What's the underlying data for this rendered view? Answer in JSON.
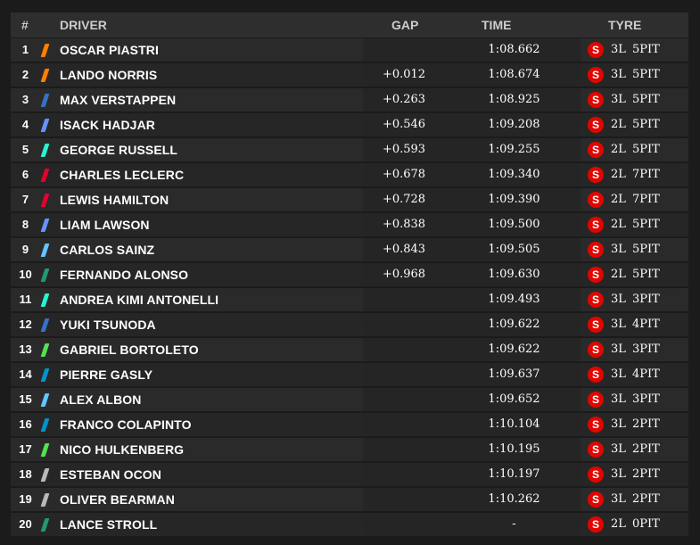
{
  "header": {
    "pos": "#",
    "driver": "DRIVER",
    "gap": "GAP",
    "time": "TIME",
    "tyre": "TYRE"
  },
  "rows": [
    {
      "pos": "1",
      "driver": "OSCAR PIASTRI",
      "gap": "",
      "time": "1:08.662",
      "tyre": "S",
      "laps": "3L",
      "pits": "5PIT",
      "color": "#ff8000"
    },
    {
      "pos": "2",
      "driver": "LANDO NORRIS",
      "gap": "+0.012",
      "time": "1:08.674",
      "tyre": "S",
      "laps": "3L",
      "pits": "5PIT",
      "color": "#ff8000"
    },
    {
      "pos": "3",
      "driver": "MAX VERSTAPPEN",
      "gap": "+0.263",
      "time": "1:08.925",
      "tyre": "S",
      "laps": "3L",
      "pits": "5PIT",
      "color": "#3671c6"
    },
    {
      "pos": "4",
      "driver": "ISACK HADJAR",
      "gap": "+0.546",
      "time": "1:09.208",
      "tyre": "S",
      "laps": "2L",
      "pits": "5PIT",
      "color": "#6692ff"
    },
    {
      "pos": "5",
      "driver": "GEORGE RUSSELL",
      "gap": "+0.593",
      "time": "1:09.255",
      "tyre": "S",
      "laps": "2L",
      "pits": "5PIT",
      "color": "#27f4d2"
    },
    {
      "pos": "6",
      "driver": "CHARLES LECLERC",
      "gap": "+0.678",
      "time": "1:09.340",
      "tyre": "S",
      "laps": "2L",
      "pits": "7PIT",
      "color": "#e8002d"
    },
    {
      "pos": "7",
      "driver": "LEWIS HAMILTON",
      "gap": "+0.728",
      "time": "1:09.390",
      "tyre": "S",
      "laps": "2L",
      "pits": "7PIT",
      "color": "#e8002d"
    },
    {
      "pos": "8",
      "driver": "LIAM LAWSON",
      "gap": "+0.838",
      "time": "1:09.500",
      "tyre": "S",
      "laps": "2L",
      "pits": "5PIT",
      "color": "#6692ff"
    },
    {
      "pos": "9",
      "driver": "CARLOS SAINZ",
      "gap": "+0.843",
      "time": "1:09.505",
      "tyre": "S",
      "laps": "3L",
      "pits": "5PIT",
      "color": "#64c4ff"
    },
    {
      "pos": "10",
      "driver": "FERNANDO ALONSO",
      "gap": "+0.968",
      "time": "1:09.630",
      "tyre": "S",
      "laps": "2L",
      "pits": "5PIT",
      "color": "#229971"
    },
    {
      "pos": "11",
      "driver": "ANDREA KIMI ANTONELLI",
      "gap": "",
      "time": "1:09.493",
      "tyre": "S",
      "laps": "3L",
      "pits": "3PIT",
      "color": "#27f4d2"
    },
    {
      "pos": "12",
      "driver": "YUKI TSUNODA",
      "gap": "",
      "time": "1:09.622",
      "tyre": "S",
      "laps": "3L",
      "pits": "4PIT",
      "color": "#3671c6"
    },
    {
      "pos": "13",
      "driver": "GABRIEL BORTOLETO",
      "gap": "",
      "time": "1:09.622",
      "tyre": "S",
      "laps": "3L",
      "pits": "3PIT",
      "color": "#52e252"
    },
    {
      "pos": "14",
      "driver": "PIERRE GASLY",
      "gap": "",
      "time": "1:09.637",
      "tyre": "S",
      "laps": "3L",
      "pits": "4PIT",
      "color": "#0093cc"
    },
    {
      "pos": "15",
      "driver": "ALEX ALBON",
      "gap": "",
      "time": "1:09.652",
      "tyre": "S",
      "laps": "3L",
      "pits": "3PIT",
      "color": "#64c4ff"
    },
    {
      "pos": "16",
      "driver": "FRANCO COLAPINTO",
      "gap": "",
      "time": "1:10.104",
      "tyre": "S",
      "laps": "3L",
      "pits": "2PIT",
      "color": "#0093cc"
    },
    {
      "pos": "17",
      "driver": "NICO HULKENBERG",
      "gap": "",
      "time": "1:10.195",
      "tyre": "S",
      "laps": "3L",
      "pits": "2PIT",
      "color": "#52e252"
    },
    {
      "pos": "18",
      "driver": "ESTEBAN OCON",
      "gap": "",
      "time": "1:10.197",
      "tyre": "S",
      "laps": "3L",
      "pits": "2PIT",
      "color": "#b6babd"
    },
    {
      "pos": "19",
      "driver": "OLIVER BEARMAN",
      "gap": "",
      "time": "1:10.262",
      "tyre": "S",
      "laps": "3L",
      "pits": "2PIT",
      "color": "#b6babd"
    },
    {
      "pos": "20",
      "driver": "LANCE STROLL",
      "gap": "",
      "time": "-",
      "tyre": "S",
      "laps": "2L",
      "pits": "0PIT",
      "color": "#229971"
    }
  ]
}
